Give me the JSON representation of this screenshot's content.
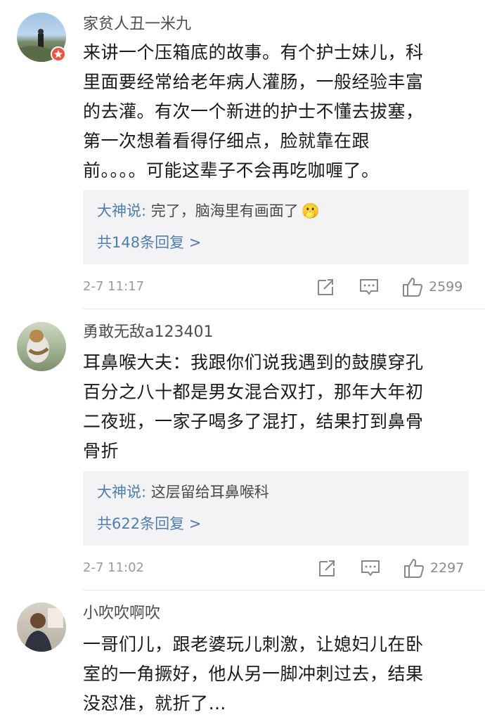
{
  "comments": [
    {
      "username": "家贫人丑一米九",
      "lines": [
        "来讲一个压箱底的故事。有个护士妹儿，科",
        "里面要经常给老年病人灌肠，一般经验丰富",
        "的去灌。有次一个新进的护士不懂去拔塞，",
        "第一次想着看得仔细点，脸就靠在跟",
        "前。。。。可能这辈子不会再吃咖喱了。"
      ],
      "reply_author": "大神说:",
      "reply_text": " 完了，脑海里有画面了",
      "reply_emoji": "🫢",
      "reply_count": "共148条回复 >",
      "time": "2-7 11:17",
      "likes": "2599"
    },
    {
      "username": "勇敢无敌a123401",
      "lines": [
        "耳鼻喉大夫：我跟你们说我遇到的鼓膜穿孔",
        "百分之八十都是男女混合双打，那年大年初",
        "二夜班，一家子喝多了混打，结果打到鼻骨",
        "骨折"
      ],
      "reply_author": "大神说:",
      "reply_text": " 这层留给耳鼻喉科",
      "reply_count": "共622条回复 >",
      "time": "2-7 11:02",
      "likes": "2297"
    },
    {
      "username": "小吹吹啊吹",
      "lines": [
        "一哥们儿，跟老婆玩儿刺激，让媳妇儿在卧",
        "室的一角撅好，他从另一脚冲刺过去，结果",
        "没怼准，就折了…"
      ]
    }
  ],
  "icons": {
    "share": "share-icon",
    "comment": "comment-icon",
    "like": "like-icon",
    "vip": "vip-badge-icon"
  },
  "colors": {
    "link": "#507daf",
    "meta": "#9a9a9a",
    "reply_bg": "#f3f3f5",
    "badge": "#f0533c"
  }
}
